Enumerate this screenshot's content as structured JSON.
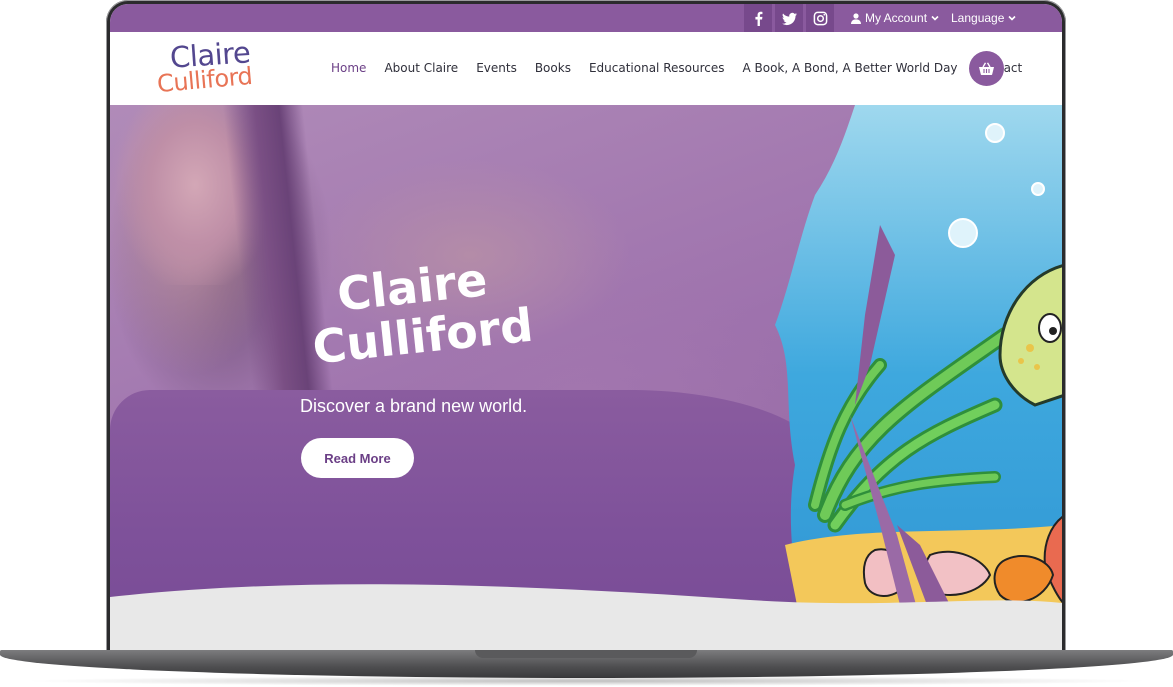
{
  "social": [
    {
      "name": "facebook-icon"
    },
    {
      "name": "twitter-icon"
    },
    {
      "name": "instagram-icon"
    }
  ],
  "topbar": {
    "account_label": "My Account",
    "language_label": "Language"
  },
  "logo": {
    "line1": "Claire",
    "line2": "Culliford"
  },
  "nav": {
    "items": [
      "Home",
      "About Claire",
      "Events",
      "Books",
      "Educational Resources",
      "A Book, A Bond, A Better World Day",
      "Contact"
    ]
  },
  "hero": {
    "title_line1": "Claire",
    "title_line2": "Culliford",
    "subtitle": "Discover a brand new world.",
    "button_label": "Read More"
  },
  "colors": {
    "brand_purple": "#8a5a9e",
    "logo_purple": "#53478f",
    "logo_orange": "#e87456",
    "button_text": "#6b3f86"
  },
  "icons": {
    "user": "user-icon",
    "chevron": "chevron-down-icon",
    "cart": "basket-icon"
  }
}
